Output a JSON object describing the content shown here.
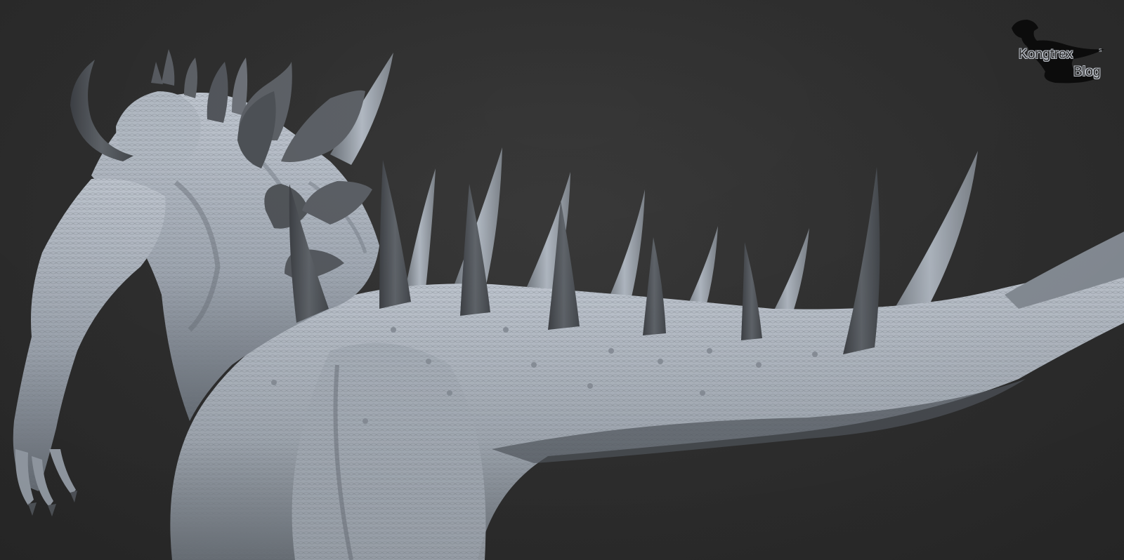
{
  "watermark": {
    "line1": "Kongtrex",
    "superscript": "s",
    "line2": "Blog"
  },
  "colors": {
    "background": "#2d2d2d",
    "skin_light": "#c3cad4",
    "skin_mid": "#9aa2ad",
    "skin_shadow": "#5c636c",
    "spike_dark": "#4e5257",
    "spike_light": "#8a9097"
  },
  "scene": {
    "subject": "dinosaur-monster-sculpt",
    "icons": [
      "trex-silhouette-icon"
    ]
  }
}
